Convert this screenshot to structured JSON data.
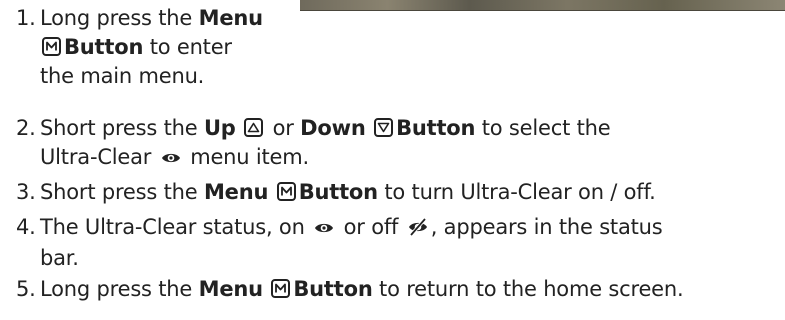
{
  "steps": [
    {
      "num": "1.",
      "a": "Long press the ",
      "menu_word": "Menu",
      "button_word": "Button",
      "c": " to enter",
      "d": "the main menu."
    },
    {
      "num": "2.",
      "a": "Short press the ",
      "up_word": "Up",
      "or_text": " or ",
      "down_word": "Down",
      "button_word": "Button",
      "b": " to select the",
      "c": "Ultra-Clear",
      "d": " menu item."
    },
    {
      "num": "3.",
      "a": "Short press the ",
      "menu_word": "Menu",
      "button_word": "Button",
      "b": " to turn Ultra-Clear on / off."
    },
    {
      "num": "4.",
      "a": "The Ultra-Clear status, on ",
      "b": " or off ",
      "c": ", appears in the status",
      "d": "bar."
    },
    {
      "num": "5.",
      "a": "Long press the ",
      "menu_word": "Menu",
      "button_word": "Button",
      "b": " to return to the home screen."
    }
  ],
  "icons": {
    "menu": "menu-button-icon",
    "up": "up-button-icon",
    "down": "down-button-icon",
    "on": "ultra-clear-on-icon",
    "off": "ultra-clear-off-icon"
  }
}
